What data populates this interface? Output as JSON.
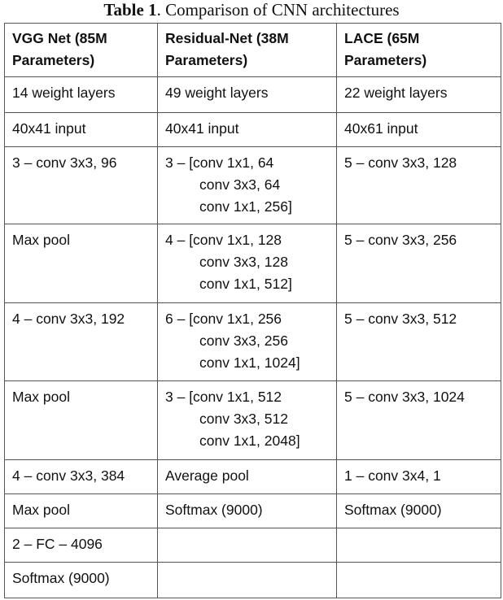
{
  "caption": {
    "label": "Table 1",
    "text": ". Comparison of CNN architectures"
  },
  "headers": [
    [
      "VGG Net (85M",
      "Parameters)"
    ],
    [
      "Residual-Net (38M",
      "Parameters)"
    ],
    [
      "LACE    (65M",
      "Parameters)"
    ]
  ],
  "rows": [
    [
      [
        "14 weight layers"
      ],
      [
        "49 weight layers"
      ],
      [
        "22 weight layers"
      ]
    ],
    [
      [
        "40x41 input"
      ],
      [
        "40x41 input"
      ],
      [
        "40x61 input"
      ]
    ],
    [
      [
        "3 – conv 3x3, 96"
      ],
      [
        "3 – [conv 1x1, 64",
        "conv 3x3, 64",
        "conv 1x1, 256]"
      ],
      [
        "5 – conv 3x3, 128"
      ]
    ],
    [
      [
        "Max pool"
      ],
      [
        "4 – [conv 1x1, 128",
        "conv 3x3, 128",
        "conv 1x1, 512]"
      ],
      [
        "5 – conv 3x3, 256"
      ]
    ],
    [
      [
        "4 – conv 3x3, 192"
      ],
      [
        "6 – [conv 1x1, 256",
        "conv 3x3, 256",
        "conv 1x1, 1024]"
      ],
      [
        "5 – conv 3x3, 512"
      ]
    ],
    [
      [
        "Max pool"
      ],
      [
        "3 – [conv 1x1, 512",
        "conv 3x3, 512",
        "conv 1x1, 2048]"
      ],
      [
        "5 – conv 3x3, 1024"
      ]
    ],
    [
      [
        "4 – conv 3x3, 384"
      ],
      [
        "Average pool"
      ],
      [
        "1 – conv 3x4, 1"
      ]
    ],
    [
      [
        "Max pool"
      ],
      [
        "Softmax (9000)"
      ],
      [
        "Softmax (9000)"
      ]
    ],
    [
      [
        "2 – FC – 4096"
      ],
      [],
      []
    ],
    [
      [
        "Softmax (9000)"
      ],
      [],
      []
    ]
  ]
}
